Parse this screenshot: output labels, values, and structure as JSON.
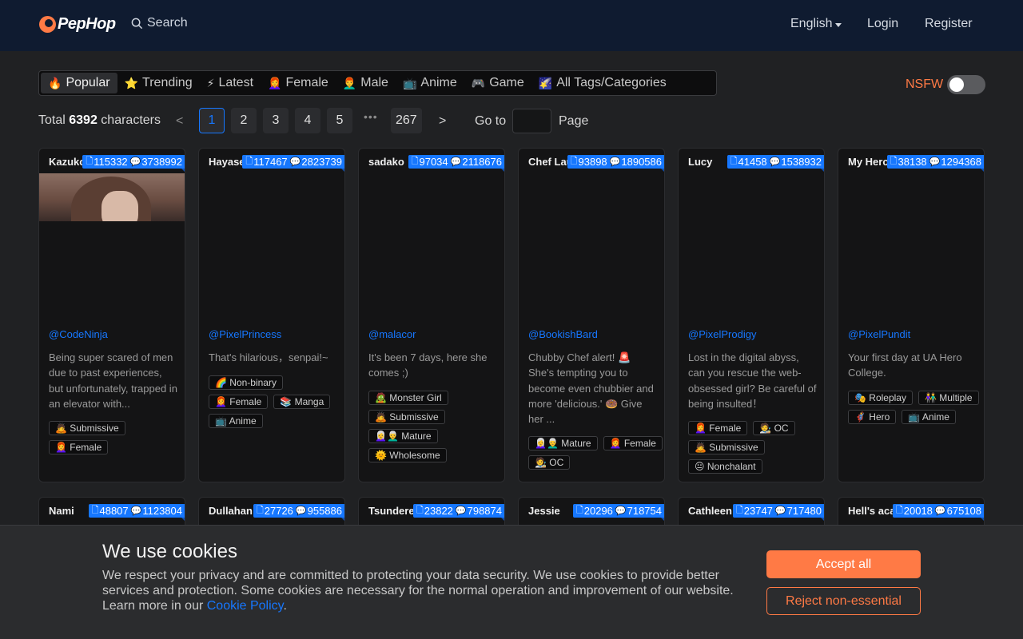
{
  "header": {
    "logo": "PepHop",
    "search_label": "Search",
    "language": "English",
    "login": "Login",
    "register": "Register"
  },
  "tabs": [
    {
      "icon": "🔥",
      "label": "Popular"
    },
    {
      "icon": "⭐",
      "label": "Trending"
    },
    {
      "icon": "⚡",
      "label": "Latest"
    },
    {
      "icon": "👩‍🦰",
      "label": "Female"
    },
    {
      "icon": "👨‍🦰",
      "label": "Male"
    },
    {
      "icon": "📺",
      "label": "Anime"
    },
    {
      "icon": "🎮",
      "label": "Game"
    },
    {
      "icon": "🌠",
      "label": "All Tags/Categories"
    }
  ],
  "nsfw": {
    "label": "NSFW",
    "enabled": false
  },
  "pagination": {
    "total_prefix": "Total",
    "total_count": "6392",
    "total_suffix": "characters",
    "prev": "<",
    "next": ">",
    "pages": [
      "1",
      "2",
      "3",
      "4",
      "5"
    ],
    "dots": "•••",
    "last_page": "267",
    "goto_label": "Go to",
    "page_label": "Page"
  },
  "cards_row1": [
    {
      "name": "Kazuko",
      "docs": "115332",
      "chats": "3738992",
      "author": "@CodeNinja",
      "desc": "Being super scared of men due to past experiences, but unfortunately, trapped in an elevator with...",
      "tags": [
        "🙇 Submissive",
        "👩‍🦰 Female"
      ]
    },
    {
      "name": "Hayase",
      "docs": "117467",
      "chats": "2823739",
      "author": "@PixelPrincess",
      "desc": "That's hilarious，senpai!~",
      "tags": [
        "🌈 Non-binary",
        "👩‍🦰 Female",
        "📚 Manga",
        "📺 Anime"
      ]
    },
    {
      "name": "sadako",
      "docs": "97034",
      "chats": "2118676",
      "author": "@malacor",
      "desc": "It's been 7 days, here she comes ;)",
      "tags": [
        "🧟 Monster Girl",
        "🙇 Submissive",
        "👩‍🦳👨‍🦳 Mature",
        "🌞 Wholesome"
      ]
    },
    {
      "name": "Chef Lau",
      "docs": "93898",
      "chats": "1890586",
      "author": "@BookishBard",
      "desc": "Chubby Chef alert! 🚨 She's tempting you to become even chubbier and more 'delicious.' 🍩 Give her ...",
      "tags": [
        "👩‍🦳👨‍🦳 Mature",
        "👩‍🦰 Female",
        "🧑‍🎨 OC"
      ]
    },
    {
      "name": "Lucy",
      "docs": "41458",
      "chats": "1538932",
      "author": "@PixelProdigy",
      "desc": "Lost in the digital abyss, can you rescue the web-obsessed girl? Be careful of being insulted！",
      "tags": [
        "👩‍🦰 Female",
        "🧑‍🎨 OC",
        "🙇 Submissive",
        "😐 Nonchalant"
      ]
    },
    {
      "name": "My Hero A",
      "docs": "38138",
      "chats": "1294368",
      "author": "@PixelPundit",
      "desc": "Your first day at UA Hero College.",
      "tags": [
        "🎭 Roleplay",
        "👫 Multiple",
        "🦸 Hero",
        "📺 Anime"
      ]
    }
  ],
  "cards_row2": [
    {
      "name": "Nami",
      "docs": "48807",
      "chats": "1123804"
    },
    {
      "name": "Dullahan",
      "docs": "27726",
      "chats": "955886"
    },
    {
      "name": "Tsundere S",
      "docs": "23822",
      "chats": "798874"
    },
    {
      "name": "Jessie",
      "docs": "20296",
      "chats": "718754"
    },
    {
      "name": "Cathleen",
      "docs": "23747",
      "chats": "717480"
    },
    {
      "name": "Hell's acad",
      "docs": "20018",
      "chats": "675108"
    }
  ],
  "cookie": {
    "title": "We use cookies",
    "text": "We respect your privacy and are committed to protecting your data security. We use cookies to provide better services and protection. Some cookies are necessary for the normal operation and improvement of our website. Learn more in our ",
    "link": "Cookie Policy",
    "period": ".",
    "accept": "Accept all",
    "reject": "Reject non-essential"
  }
}
